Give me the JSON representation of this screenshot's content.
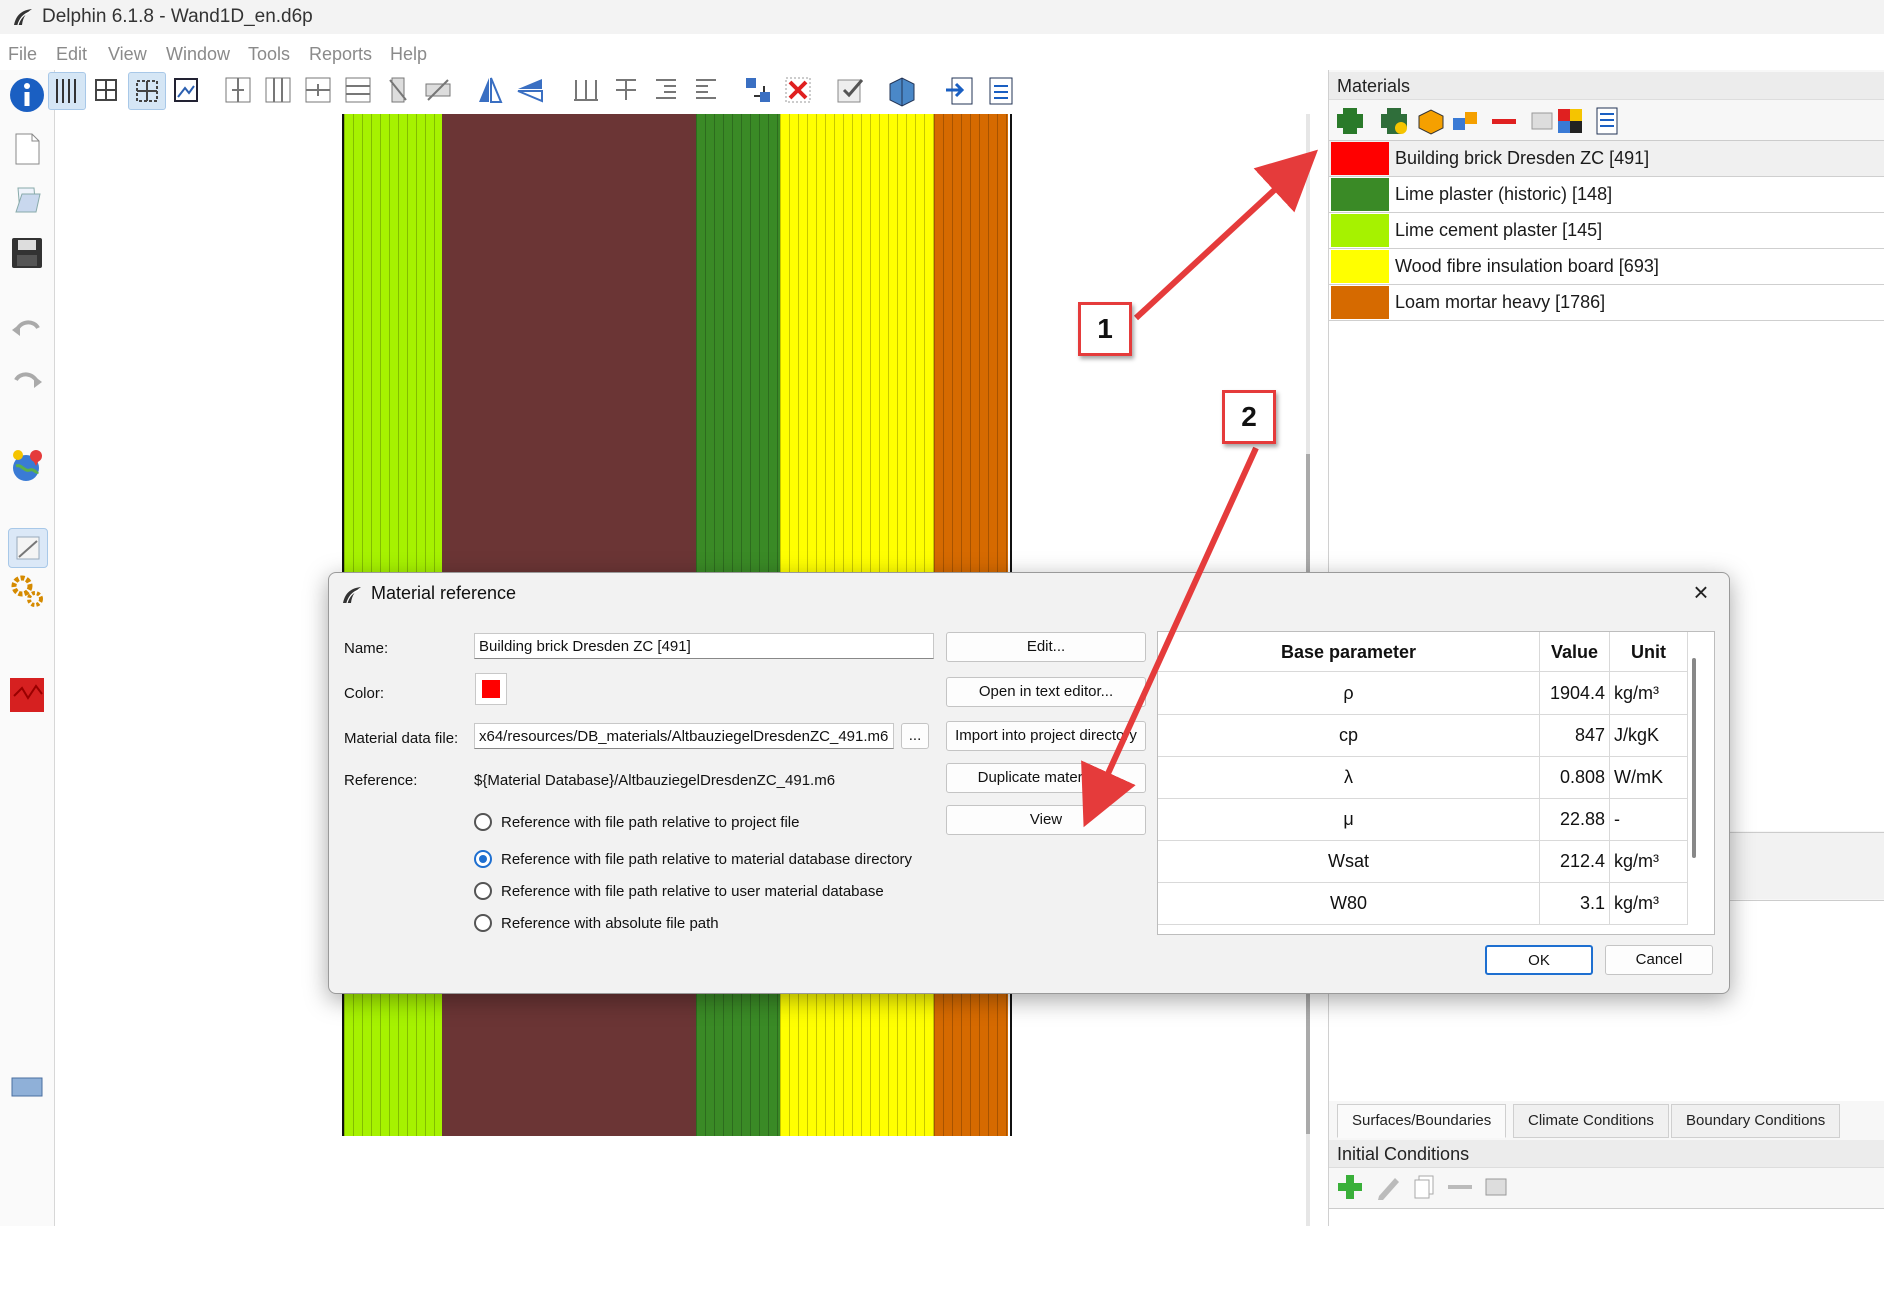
{
  "window": {
    "title": "Delphin 6.1.8 - Wand1D_en.d6p"
  },
  "menu": [
    "File",
    "Edit",
    "View",
    "Window",
    "Tools",
    "Reports",
    "Help"
  ],
  "materials_panel": {
    "title": "Materials",
    "items": [
      {
        "label": "Building brick Dresden ZC [491]",
        "color": "#ff0000"
      },
      {
        "label": "Lime plaster (historic) [148]",
        "color": "#3a8a26"
      },
      {
        "label": "Lime cement plaster [145]",
        "color": "#a6f200"
      },
      {
        "label": "Wood fibre insulation board [693]",
        "color": "#ffff00"
      },
      {
        "label": "Loam mortar heavy [1786]",
        "color": "#d66a00"
      }
    ]
  },
  "lower_panel": {
    "tabs": [
      "Surfaces/Boundaries",
      "Climate Conditions",
      "Boundary Conditions"
    ],
    "section_title": "Initial Conditions"
  },
  "construction_layers": [
    {
      "name": "lime-cement-plaster",
      "color": "#a6f200"
    },
    {
      "name": "building-brick",
      "color": "#6b3535"
    },
    {
      "name": "lime-plaster",
      "color": "#3a8a26"
    },
    {
      "name": "wood-fibre-insulation",
      "color": "#ffff00"
    },
    {
      "name": "loam-mortar",
      "color": "#d66a00"
    }
  ],
  "dialog": {
    "title": "Material reference",
    "name_label": "Name:",
    "name_value": "Building brick Dresden ZC [491]",
    "color_label": "Color:",
    "color_value": "#ff0000",
    "data_file_label": "Material data file:",
    "data_file_value": "x64/resources/DB_materials/AltbauziegelDresdenZC_491.m6",
    "browse_label": "...",
    "reference_label": "Reference:",
    "reference_value": "${Material Database}/AltbauziegelDresdenZC_491.m6",
    "radio_options": [
      {
        "label": "Reference with file path relative to project file",
        "checked": false
      },
      {
        "label": "Reference with file path relative to material database directory",
        "checked": true
      },
      {
        "label": "Reference with file path relative to user material database",
        "checked": false
      },
      {
        "label": "Reference with absolute file path",
        "checked": false
      }
    ],
    "buttons": {
      "edit": "Edit...",
      "open_text_editor": "Open in text editor...",
      "import_project": "Import into project directory",
      "duplicate": "Duplicate material ...",
      "view": "View",
      "ok": "OK",
      "cancel": "Cancel"
    },
    "param_table": {
      "headers": [
        "Base parameter",
        "Value",
        "Unit"
      ],
      "rows": [
        [
          "ρ",
          "1904.4",
          "kg/m³"
        ],
        [
          "cp",
          "847",
          "J/kgK"
        ],
        [
          "λ",
          "0.808",
          "W/mK"
        ],
        [
          "μ",
          "22.88",
          "-"
        ],
        [
          "Wsat",
          "212.4",
          "kg/m³"
        ],
        [
          "W80",
          "3.1",
          "kg/m³"
        ]
      ]
    }
  },
  "annotations": {
    "callout_1": "1",
    "callout_2": "2",
    "color": "#e53b3b"
  }
}
